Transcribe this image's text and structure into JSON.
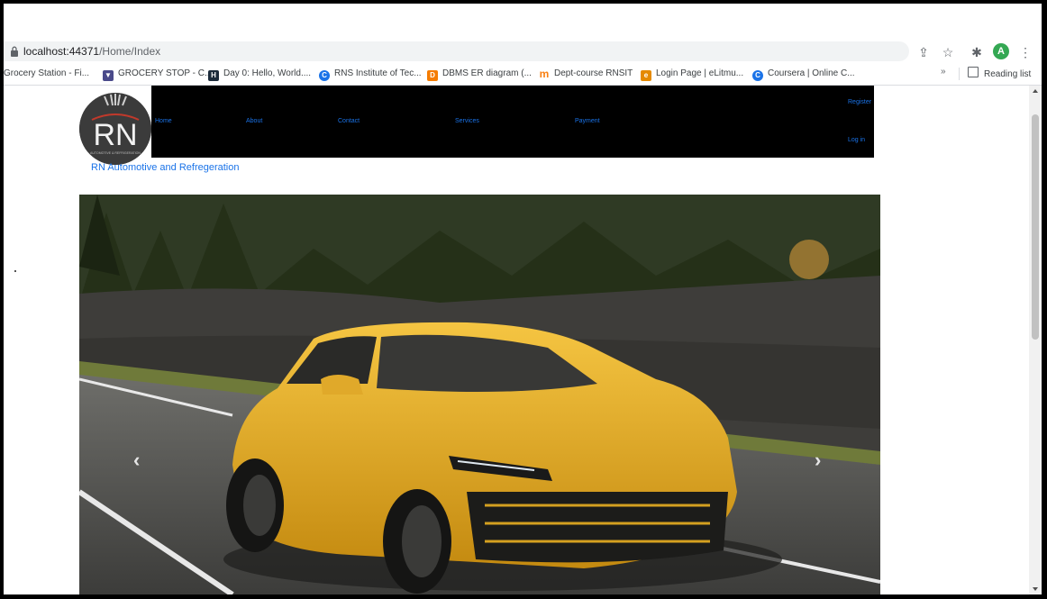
{
  "browser": {
    "url_host": "localhost:44371",
    "url_path": "/Home/Index",
    "avatar_initial": "A",
    "bookmarks": [
      {
        "label": "Grocery Station - Fi...",
        "icon": "grocery-icon"
      },
      {
        "label": "GROCERY STOP - C...",
        "icon": "cart-icon",
        "color": "#4a4a8a"
      },
      {
        "label": "Day 0: Hello, World....",
        "icon": "hackerrank-icon",
        "color": "#1b2a3a"
      },
      {
        "label": "RNS Institute of Tec...",
        "icon": "globe-icon",
        "color": "#1a73e8"
      },
      {
        "label": "DBMS ER diagram (...",
        "icon": "diagram-icon",
        "color": "#f57c00"
      },
      {
        "label": "Dept-course RNSIT",
        "icon": "moodle-icon",
        "color": "#f98012"
      },
      {
        "label": "Login Page | eLitmu...",
        "icon": "elitmus-icon",
        "color": "#e58a00"
      },
      {
        "label": "Coursera | Online C...",
        "icon": "coursera-icon",
        "color": "#1a73e8"
      }
    ],
    "more_label": "»",
    "reading_list": "Reading list"
  },
  "site": {
    "nav": [
      {
        "label": "Home"
      },
      {
        "label": "About"
      },
      {
        "label": "Contact"
      },
      {
        "label": "Services"
      },
      {
        "label": "Payment"
      }
    ],
    "register": "Register",
    "login": "Log in",
    "brand": "RN Automotive and Refregeration",
    "logo_text": "RN",
    "logo_subtext": "AUTOMOTIVE & REFRIGERATION"
  },
  "carousel": {
    "prev": "‹",
    "next": "›"
  }
}
